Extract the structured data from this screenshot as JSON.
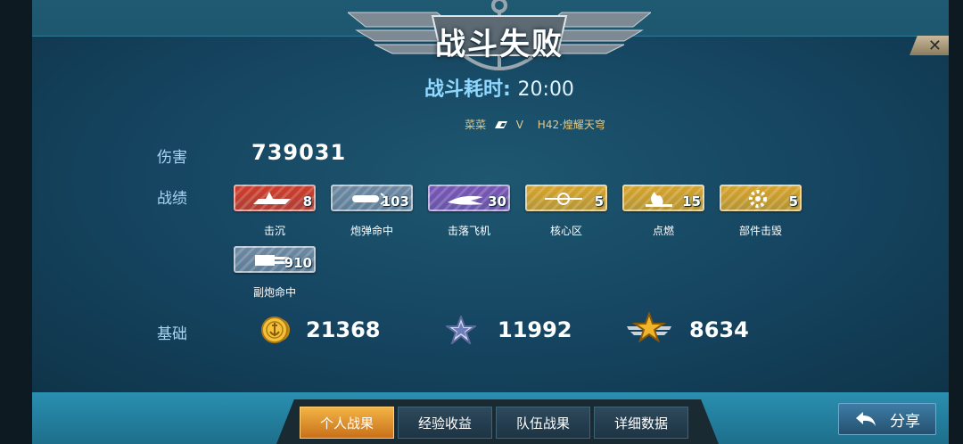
{
  "header": {
    "title": "战斗失败",
    "close_symbol": "✕"
  },
  "duration": {
    "label": "战斗耗时:",
    "value": "20:00"
  },
  "players": {
    "left": "菜菜",
    "vs": "V",
    "right": "H42·煌耀天穹"
  },
  "damage": {
    "label": "伤害",
    "value": "739031"
  },
  "record": {
    "label": "战绩",
    "items": [
      {
        "caption": "击沉",
        "count": "8",
        "color": "#d23c2a",
        "icon": "sinking-ship-icon"
      },
      {
        "caption": "炮弹命中",
        "count": "103",
        "color": "#6f8aa3",
        "icon": "shell-icon"
      },
      {
        "caption": "击落飞机",
        "count": "30",
        "color": "#7a56b8",
        "icon": "plane-icon"
      },
      {
        "caption": "核心区",
        "count": "5",
        "color": "#d9a52a",
        "icon": "crosshair-icon"
      },
      {
        "caption": "点燃",
        "count": "15",
        "color": "#d9a52a",
        "icon": "fire-icon"
      },
      {
        "caption": "部件击毁",
        "count": "5",
        "color": "#d9a52a",
        "icon": "gear-icon"
      },
      {
        "caption": "副炮命中",
        "count": "910",
        "color": "#6f8aa3",
        "icon": "secondary-gun-icon"
      }
    ]
  },
  "basics": {
    "label": "基础",
    "coins": "21368",
    "silver_star": "11992",
    "gold_star": "8634"
  },
  "tabs": [
    {
      "label": "个人战果",
      "active": true
    },
    {
      "label": "经验收益",
      "active": false
    },
    {
      "label": "队伍战果",
      "active": false
    },
    {
      "label": "详细数据",
      "active": false
    }
  ],
  "share": {
    "label": "分享"
  }
}
